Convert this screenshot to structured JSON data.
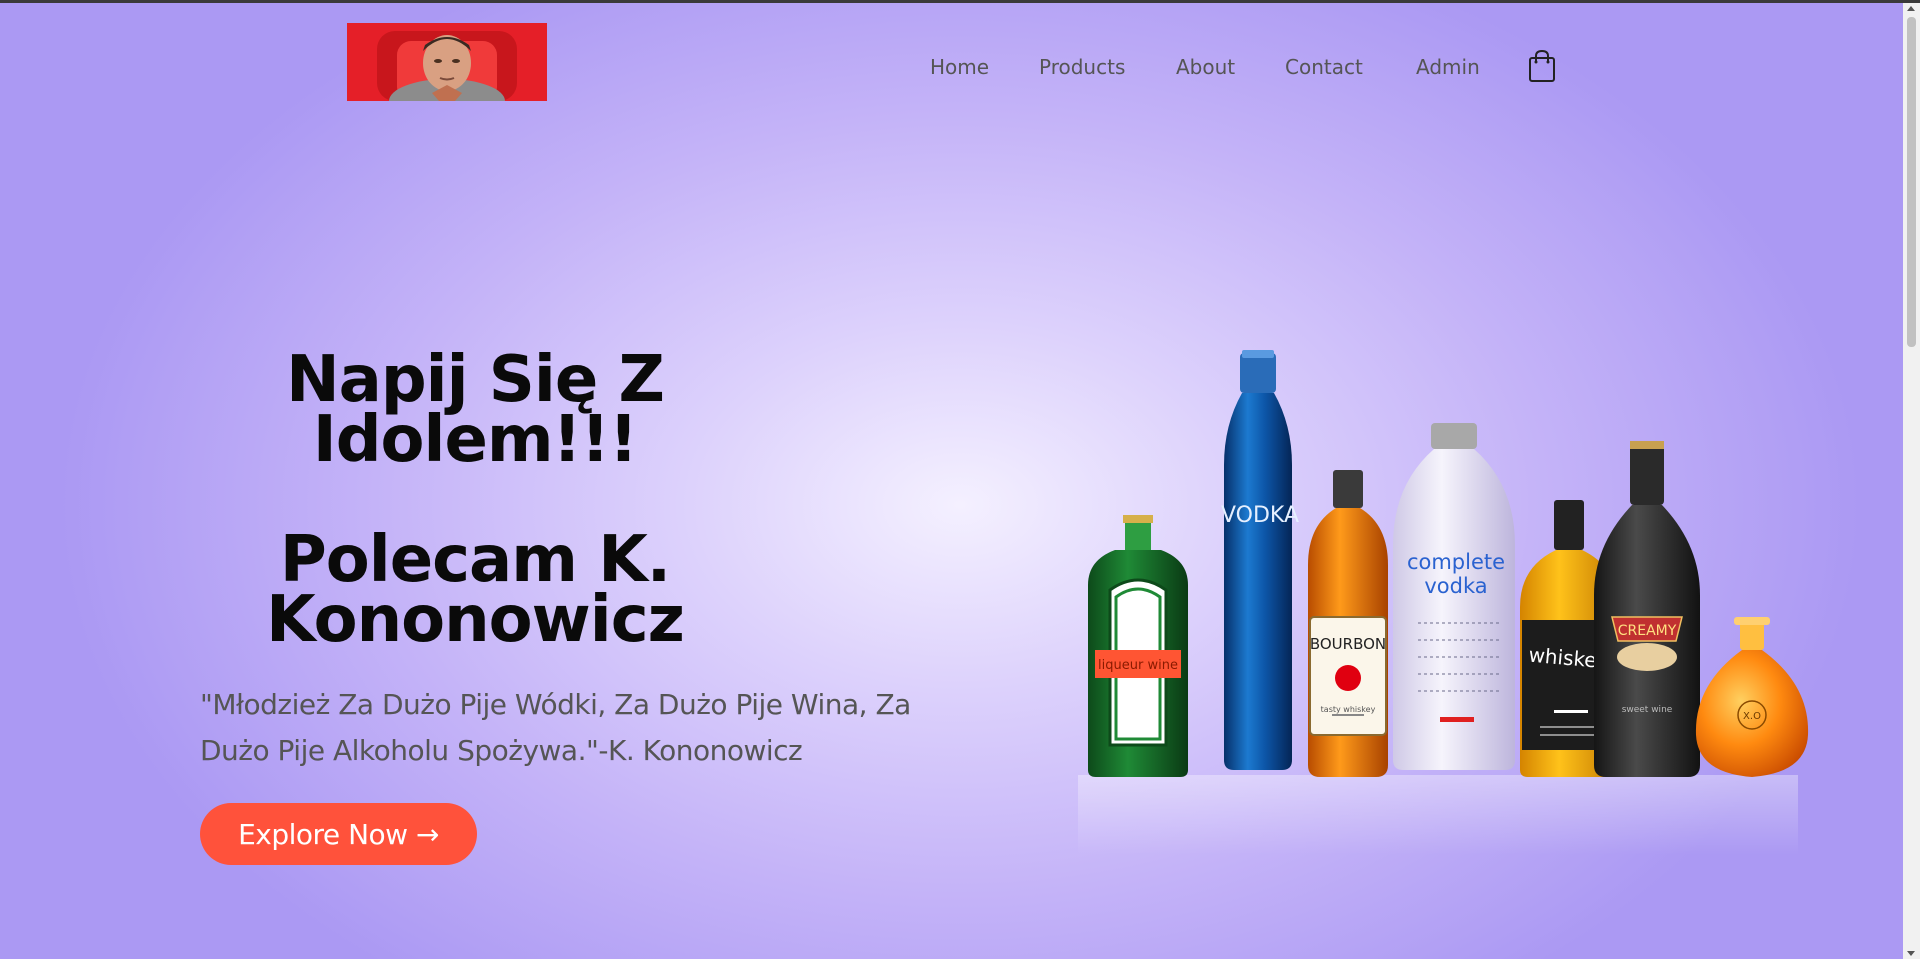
{
  "nav": {
    "items": [
      {
        "label": "Home"
      },
      {
        "label": "Products"
      },
      {
        "label": "About"
      },
      {
        "label": "Contact"
      },
      {
        "label": "Admin"
      }
    ],
    "cart_icon": "shopping-bag-icon"
  },
  "hero": {
    "title_line1": "Napij Się Z",
    "title_line2": "Idolem!!!",
    "subtitle_line1": "Polecam K.",
    "subtitle_line2": "Kononowicz",
    "quote": "\"Młodzież Za Dużo Pije Wódki, Za Dużo Pije Wina, Za Dużo Pije Alkoholu Spożywa.\"-K. Kononowicz",
    "cta_label": "Explore Now →"
  },
  "bottles": {
    "liqueur_label": "liqueur wine",
    "vodka_label": "VODKA",
    "bourbon_label": "BOURBON",
    "bourbon_sub": "tasty whiskey",
    "complete_line1": "complete",
    "complete_line2": "vodka",
    "whiskey_label": "whiskey",
    "creamy_label": "CREAMY",
    "creamy_sub": "sweet wine",
    "xo_label": "X.O"
  },
  "colors": {
    "accent": "#ff523b",
    "nav_text": "#555555",
    "title": "#0a0a0a"
  }
}
